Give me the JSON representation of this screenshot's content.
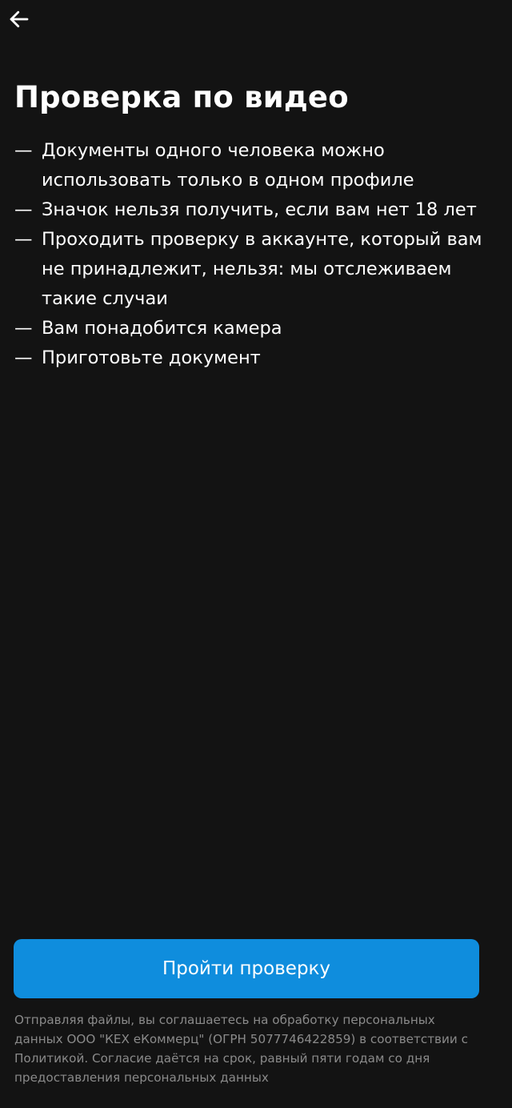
{
  "header": {
    "back_icon": "arrow-left-icon"
  },
  "page": {
    "title": "Проверка по видео"
  },
  "rules": {
    "dash": "—",
    "items": [
      "Документы одного человека можно использовать только в одном профиле",
      "Значок нельзя получить, если вам нет 18 лет",
      "Проходить проверку в аккаунте, который вам не принадлежит, нельзя: мы отслеживаем такие случаи",
      "Вам понадобится камера",
      "Приготовьте документ"
    ]
  },
  "actions": {
    "submit_label": "Пройти проверку"
  },
  "consent": {
    "text": "Отправляя файлы, вы соглашаетесь на обработку персональных данных ООО \"КЕХ еКоммерц\" (ОГРН 5077746422859) в соответствии с Политикой. Согласие даётся на срок, равный пяти годам со дня предоставления персональных данных"
  },
  "colors": {
    "background": "#131313",
    "accent": "#0f8ddd",
    "text_primary": "#ffffff",
    "text_secondary": "#8a8a8a"
  }
}
